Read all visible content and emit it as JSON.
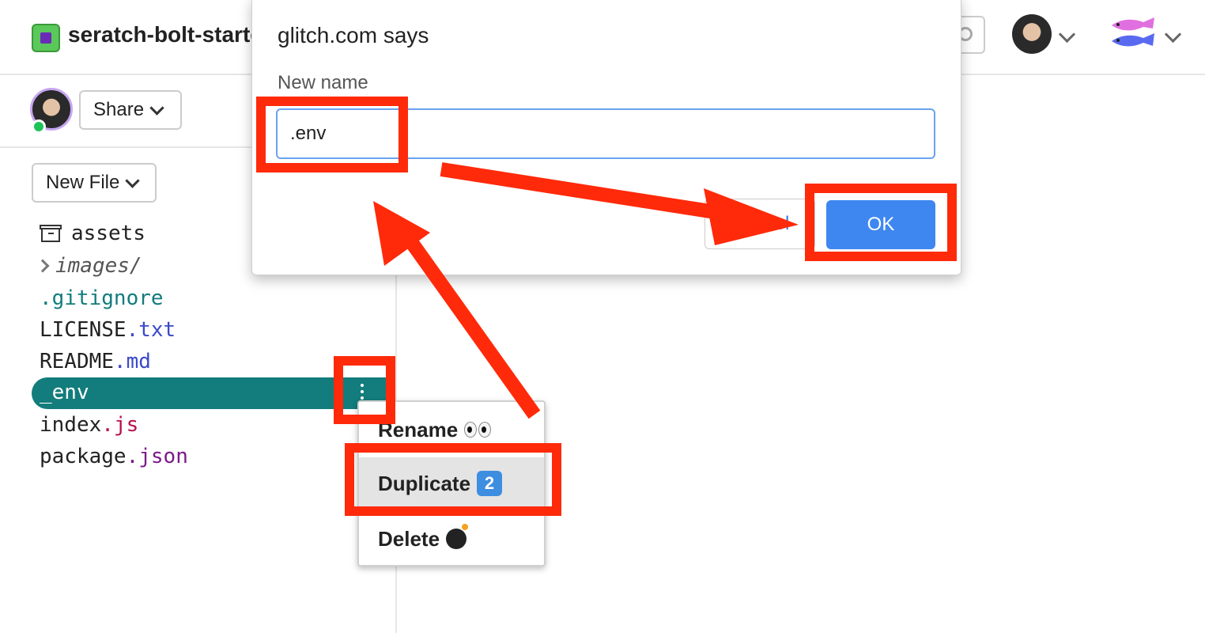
{
  "header": {
    "project_name": "seratch-bolt-starter"
  },
  "sidebar": {
    "share_label": "Share",
    "new_file_label": "New File",
    "files": [
      {
        "base": "assets",
        "ext": ""
      },
      {
        "base": "images/",
        "ext": ""
      },
      {
        "base": "",
        "ext": ".gitignore"
      },
      {
        "base": "LICENSE",
        "ext": ".txt"
      },
      {
        "base": "README",
        "ext": ".md"
      },
      {
        "base": "_env",
        "ext": ""
      },
      {
        "base": "index",
        "ext": ".js"
      },
      {
        "base": "package",
        "ext": ".json"
      }
    ]
  },
  "context_menu": {
    "rename": "Rename",
    "duplicate": "Duplicate",
    "duplicate_badge": "2",
    "delete": "Delete"
  },
  "dialog": {
    "title": "glitch.com says",
    "label": "New name",
    "input_value": ".env",
    "cancel_label": "Cancel",
    "ok_label": "OK"
  },
  "colors": {
    "selected_row": "#137c7c",
    "ok_button": "#3e87f0",
    "annotation": "#ff2a0a"
  }
}
